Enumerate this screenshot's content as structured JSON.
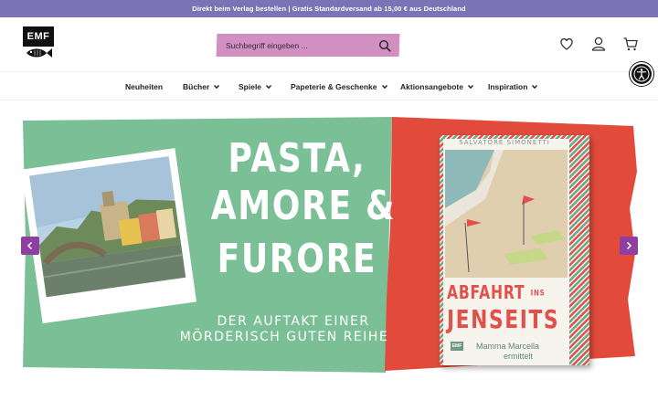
{
  "topbar": {
    "text": "Direkt beim Verlag bestellen | Gratis Standardversand ab 15,00 € aus Deutschland"
  },
  "header": {
    "logo_text": "EMF",
    "search_placeholder": "Suchbegriff eingeben ...",
    "icons": [
      "heart-icon",
      "user-icon",
      "cart-icon"
    ]
  },
  "nav": {
    "items": [
      {
        "label": "Neuheiten",
        "has_dropdown": false
      },
      {
        "label": "Bücher",
        "has_dropdown": true
      },
      {
        "label": "Spiele",
        "has_dropdown": true
      },
      {
        "label": "Papeterie & Geschenke",
        "has_dropdown": true
      },
      {
        "label": "Aktionsangebote",
        "has_dropdown": true
      },
      {
        "label": "Inspiration",
        "has_dropdown": true
      }
    ]
  },
  "banner": {
    "headline_1": "PASTA,",
    "headline_2": "AMORE &",
    "headline_3": "FURORE",
    "subline_1": "DER AUFTAKT EINER",
    "subline_2": "MÖRDERISCH GUTEN REIHE",
    "book": {
      "author": "SALVATORE SIMONETTI",
      "title_1": "ABFAHRT",
      "title_1b": "INS",
      "title_2": "JENSEITS",
      "subtitle_1": "Mamma Marcella",
      "subtitle_2": "ermittelt",
      "logo": "EMF"
    }
  },
  "colors": {
    "topbar": "#7a73b5",
    "search": "#d28fc2",
    "banner_green": "#7bbf96",
    "banner_red": "#e24b3c",
    "slider_arrow": "#8f3fa0"
  }
}
